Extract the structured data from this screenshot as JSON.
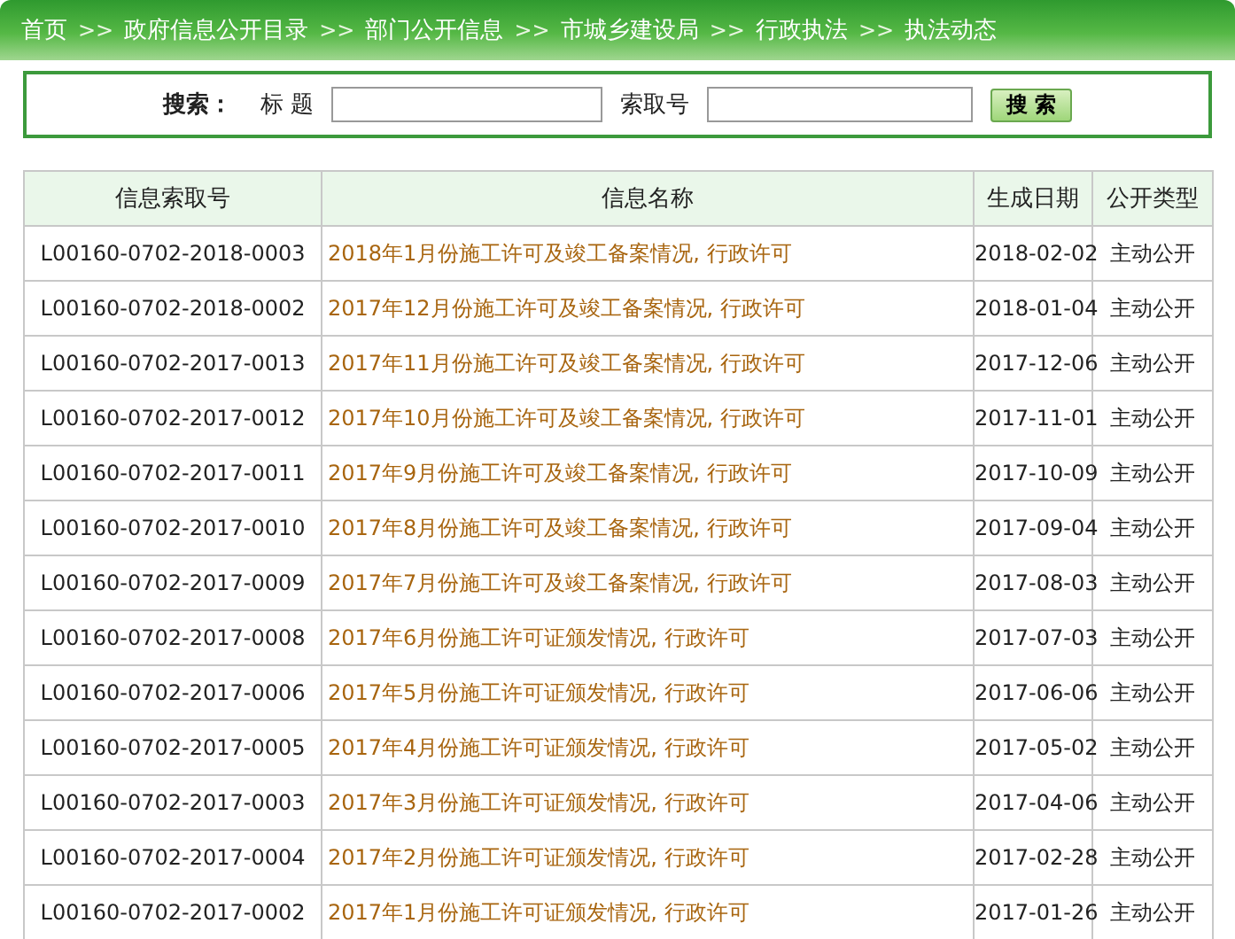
{
  "breadcrumb": [
    {
      "kind": "link",
      "text": "首页"
    },
    {
      "kind": "separator",
      "text": ">>"
    },
    {
      "kind": "link",
      "text": "政府信息公开目录"
    },
    {
      "kind": "separator",
      "text": ">>"
    },
    {
      "kind": "link",
      "text": "部门公开信息"
    },
    {
      "kind": "separator",
      "text": ">>"
    },
    {
      "kind": "link",
      "text": "市城乡建设局"
    },
    {
      "kind": "separator",
      "text": ">>"
    },
    {
      "kind": "link",
      "text": "行政执法"
    },
    {
      "kind": "separator",
      "text": ">>"
    },
    {
      "kind": "link",
      "text": "执法动态"
    }
  ],
  "search": {
    "label": "搜索：",
    "title_label": "标 题",
    "index_label": "索取号",
    "button": "搜 索"
  },
  "table": {
    "columns": [
      "信息索取号",
      "信息名称",
      "生成日期",
      "公开类型"
    ],
    "rows": [
      {
        "index": "L00160-0702-2018-0003",
        "name": "2018年1月份施工许可及竣工备案情况, 行政许可",
        "date": "2018-02-02",
        "type": "主动公开"
      },
      {
        "index": "L00160-0702-2018-0002",
        "name": "2017年12月份施工许可及竣工备案情况, 行政许可",
        "date": "2018-01-04",
        "type": "主动公开"
      },
      {
        "index": "L00160-0702-2017-0013",
        "name": "2017年11月份施工许可及竣工备案情况, 行政许可",
        "date": "2017-12-06",
        "type": "主动公开"
      },
      {
        "index": "L00160-0702-2017-0012",
        "name": "2017年10月份施工许可及竣工备案情况, 行政许可",
        "date": "2017-11-01",
        "type": "主动公开"
      },
      {
        "index": "L00160-0702-2017-0011",
        "name": "2017年9月份施工许可及竣工备案情况, 行政许可",
        "date": "2017-10-09",
        "type": "主动公开"
      },
      {
        "index": "L00160-0702-2017-0010",
        "name": "2017年8月份施工许可及竣工备案情况, 行政许可",
        "date": "2017-09-04",
        "type": "主动公开"
      },
      {
        "index": "L00160-0702-2017-0009",
        "name": "2017年7月份施工许可及竣工备案情况, 行政许可",
        "date": "2017-08-03",
        "type": "主动公开"
      },
      {
        "index": "L00160-0702-2017-0008",
        "name": "2017年6月份施工许可证颁发情况, 行政许可",
        "date": "2017-07-03",
        "type": "主动公开"
      },
      {
        "index": "L00160-0702-2017-0006",
        "name": "2017年5月份施工许可证颁发情况, 行政许可",
        "date": "2017-06-06",
        "type": "主动公开"
      },
      {
        "index": "L00160-0702-2017-0005",
        "name": "2017年4月份施工许可证颁发情况, 行政许可",
        "date": "2017-05-02",
        "type": "主动公开"
      },
      {
        "index": "L00160-0702-2017-0003",
        "name": "2017年3月份施工许可证颁发情况, 行政许可",
        "date": "2017-04-06",
        "type": "主动公开"
      },
      {
        "index": "L00160-0702-2017-0004",
        "name": "2017年2月份施工许可证颁发情况, 行政许可",
        "date": "2017-02-28",
        "type": "主动公开"
      },
      {
        "index": "L00160-0702-2017-0002",
        "name": "2017年1月份施工许可证颁发情况, 行政许可",
        "date": "2017-01-26",
        "type": "主动公开"
      }
    ]
  }
}
